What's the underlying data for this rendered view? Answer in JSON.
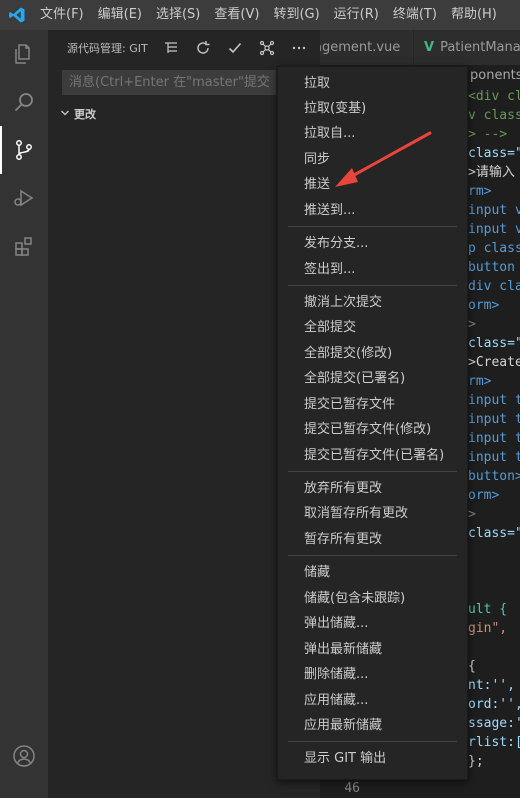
{
  "titlebar": {
    "menu": [
      "文件(F)",
      "编辑(E)",
      "选择(S)",
      "查看(V)",
      "转到(G)",
      "运行(R)",
      "终端(T)",
      "帮助(H)"
    ]
  },
  "sidebar": {
    "title": "源代码管理: GIT",
    "commit_placeholder": "消息(Ctrl+Enter 在\"master\"提交)",
    "changes_label": "更改"
  },
  "editor": {
    "tab1_label": "agement.vue",
    "tab2_label": "PatientMana",
    "breadcrumb": "ponents",
    "lines": [
      {
        "text": "<div cl",
        "color": "#6a9955"
      },
      {
        "text": "v class",
        "color": "#6a9955"
      },
      {
        "text": "> -->",
        "color": "#6a9955"
      },
      {
        "text": "class=\"",
        "color": "#9cdcfe"
      },
      {
        "text": ">请输入",
        "color": "#d4d4d4"
      },
      {
        "text": "rm>",
        "color": "#569cd6"
      },
      {
        "text": "input v",
        "color": "#569cd6"
      },
      {
        "text": "input v",
        "color": "#569cd6"
      },
      {
        "text": "p class",
        "color": "#569cd6"
      },
      {
        "text": "button",
        "color": "#569cd6"
      },
      {
        "text": "div cla",
        "color": "#569cd6"
      },
      {
        "text": "orm>",
        "color": "#569cd6"
      },
      {
        "text": ">",
        "color": "#808080"
      },
      {
        "text": "class=\"",
        "color": "#9cdcfe"
      },
      {
        "text": ">Create",
        "color": "#d4d4d4"
      },
      {
        "text": "rm>",
        "color": "#569cd6"
      },
      {
        "text": "input t",
        "color": "#569cd6"
      },
      {
        "text": "input t",
        "color": "#569cd6"
      },
      {
        "text": "input t",
        "color": "#569cd6"
      },
      {
        "text": "input t",
        "color": "#569cd6"
      },
      {
        "text": "button>",
        "color": "#569cd6"
      },
      {
        "text": "orm>",
        "color": "#569cd6"
      },
      {
        "text": ">",
        "color": "#808080"
      },
      {
        "text": "class=\"",
        "color": "#9cdcfe"
      },
      {
        "text": "",
        "color": "#d4d4d4"
      },
      {
        "text": "",
        "color": "#d4d4d4"
      },
      {
        "text": "",
        "color": "#d4d4d4"
      },
      {
        "text": "ult {",
        "color": "#4ec9b0"
      },
      {
        "text": "gin\",",
        "color": "#ce9178"
      },
      {
        "text": "",
        "color": "#d4d4d4"
      },
      {
        "text": "{",
        "color": "#d4d4d4"
      },
      {
        "text": "nt:'',",
        "color": "#9cdcfe"
      },
      {
        "text": "ord:'',",
        "color": "#9cdcfe"
      },
      {
        "text": "ssage:'",
        "color": "#9cdcfe"
      },
      {
        "text": "rlist:[",
        "color": "#9cdcfe"
      },
      {
        "text": "};",
        "color": "#d4d4d4"
      }
    ],
    "last_line_number": "46"
  },
  "context_menu": {
    "items": [
      "拉取",
      "拉取(变基)",
      "拉取自...",
      "同步",
      "推送",
      "推送到...",
      "发布分支...",
      "签出到...",
      "撤消上次提交",
      "全部提交",
      "全部提交(修改)",
      "全部提交(已署名)",
      "提交已暂存文件",
      "提交已暂存文件(修改)",
      "提交已暂存文件(已署名)",
      "放弃所有更改",
      "取消暂存所有更改",
      "暂存所有更改",
      "储藏",
      "储藏(包含未跟踪)",
      "弹出储藏...",
      "弹出最新储藏",
      "删除储藏...",
      "应用储藏...",
      "应用最新储藏",
      "显示 GIT 输出"
    ]
  },
  "colors": {
    "accent": "#007acc",
    "annotation_arrow": "#e8453c"
  }
}
